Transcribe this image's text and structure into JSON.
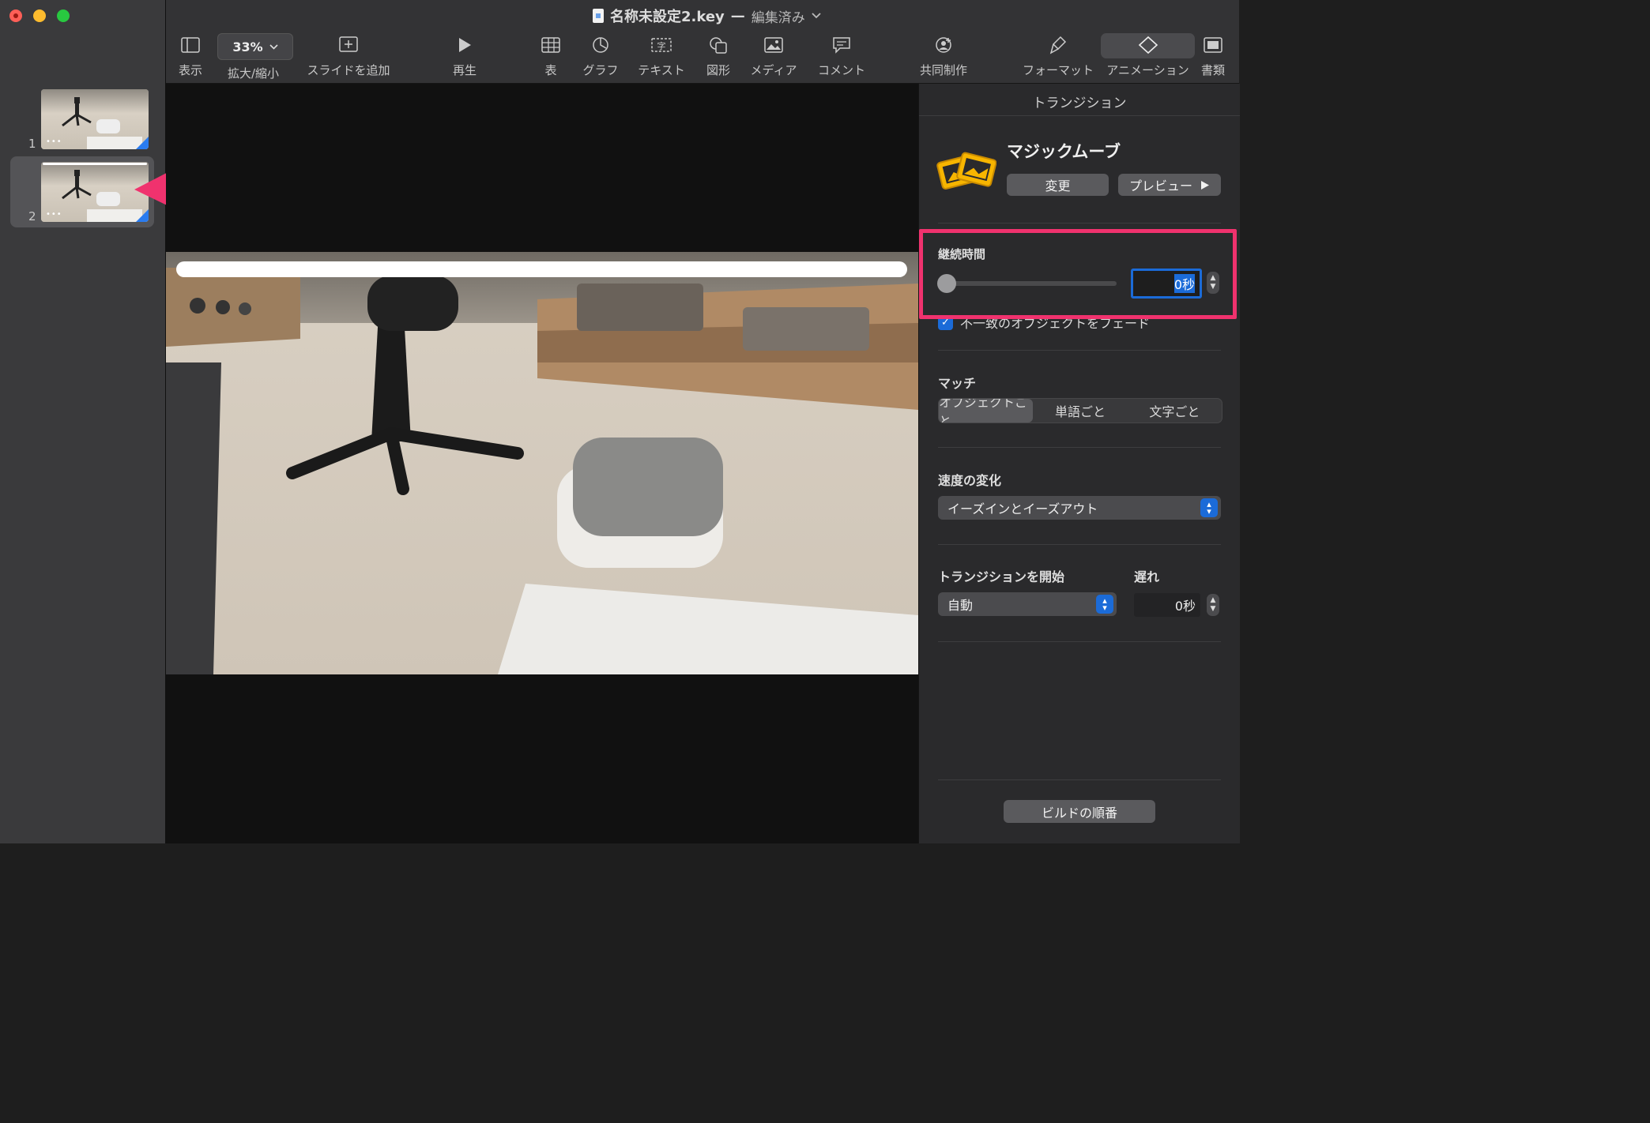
{
  "window": {
    "doc_name": "名称未設定2.key",
    "separator": "—",
    "status": "編集済み"
  },
  "toolbar": {
    "view_label": "表示",
    "zoom_value": "33%",
    "zoom_label": "拡大/縮小",
    "add_slide_label": "スライドを追加",
    "play_label": "再生",
    "table_label": "表",
    "chart_label": "グラフ",
    "text_label": "テキスト",
    "shape_label": "図形",
    "media_label": "メディア",
    "comment_label": "コメント",
    "collaborate_label": "共同制作",
    "format_label": "フォーマット",
    "animate_label": "アニメーション",
    "document_label": "書類"
  },
  "slides": [
    {
      "number": "1",
      "dots": "•••"
    },
    {
      "number": "2",
      "dots": "•••"
    }
  ],
  "inspector": {
    "header": "トランジション",
    "transition_name": "マジックムーブ",
    "change_button": "変更",
    "preview_button": "プレビュー",
    "duration_label": "継続時間",
    "duration_value": "0秒",
    "duration_slider_fraction": 0,
    "fade_checkbox_label": "不一致のオブジェクトをフェード",
    "fade_checked": true,
    "match_label": "マッチ",
    "match_options": [
      "オブジェクトごと",
      "単語ごと",
      "文字ごと"
    ],
    "match_selected": "オブジェクトごと",
    "acceleration_label": "速度の変化",
    "acceleration_value": "イーズインとイーズアウト",
    "start_label": "トランジションを開始",
    "start_value": "自動",
    "delay_label": "遅れ",
    "delay_value": "0秒",
    "build_order_button": "ビルドの順番"
  },
  "colors": {
    "annotation": "#f0326e",
    "accent": "#1b6bd8"
  }
}
